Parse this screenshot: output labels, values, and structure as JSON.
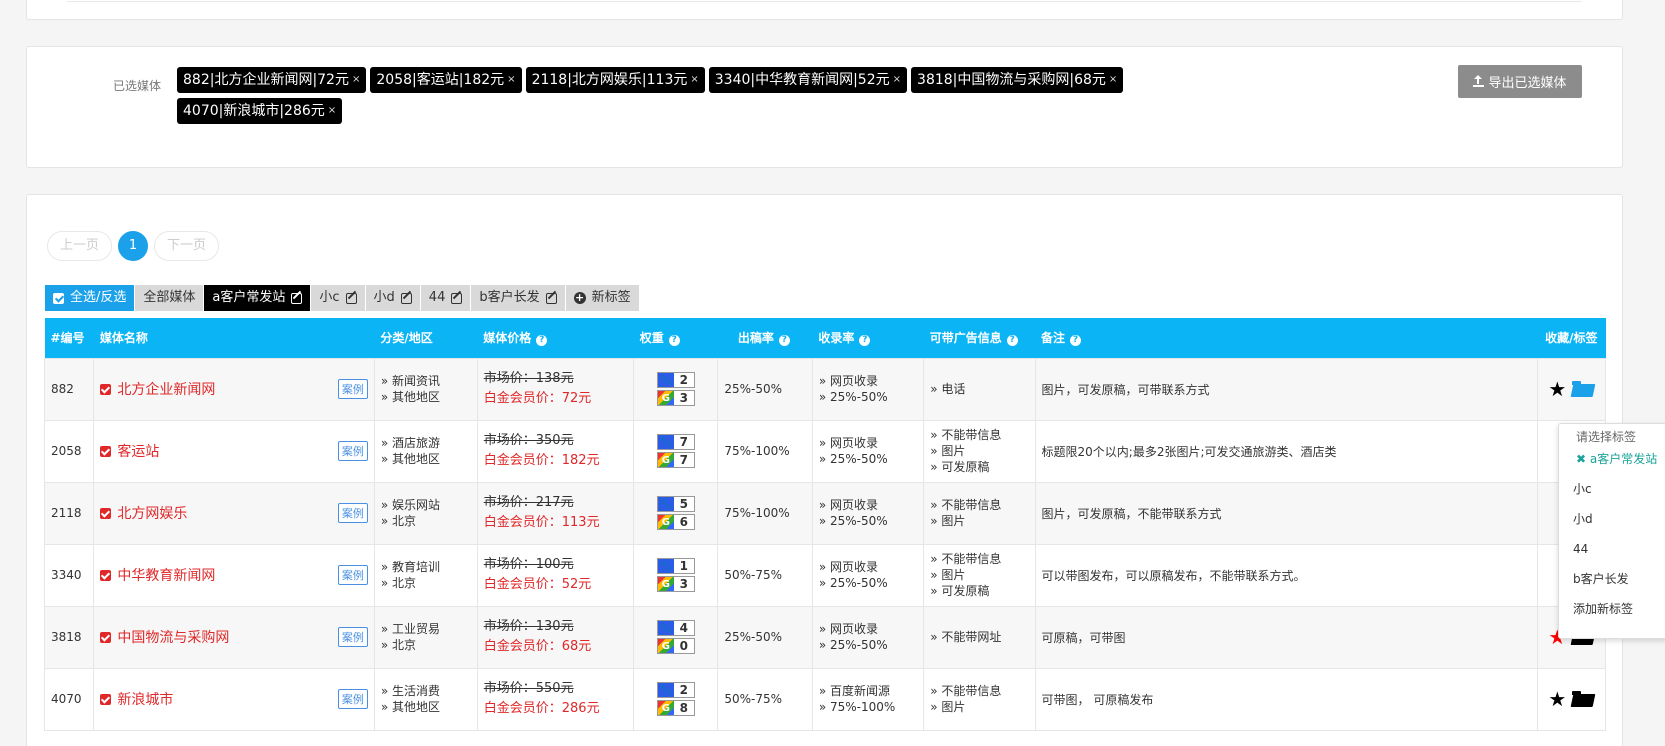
{
  "selected": {
    "label": "已选媒体",
    "tags": [
      "882|北方企业新闻网|72元",
      "2058|客运站|182元",
      "2118|北方网娱乐|113元",
      "3340|中华教育新闻网|52元",
      "3818|中国物流与采购网|68元",
      "4070|新浪城市|286元"
    ],
    "tag_close": "×",
    "export_label": "导出已选媒体"
  },
  "pager": {
    "prev": "上一页",
    "current": "1",
    "next": "下一页"
  },
  "tabs": {
    "select_all": "全选/反选",
    "all_media": "全部媒体",
    "items": [
      "a客户常发站",
      "小c",
      "小d",
      "44",
      "b客户长发"
    ],
    "new_tag": "新标签"
  },
  "table": {
    "headers": [
      "#编号",
      "媒体名称",
      "分类/地区",
      "媒体价格",
      "权重",
      "出稿率",
      "收录率",
      "可带广告信息",
      "备注",
      "收藏/标签"
    ],
    "case_label": "案例",
    "rows": [
      {
        "id": "882",
        "name": "北方企业新闻网",
        "cat": [
          "新闻资讯",
          "其他地区"
        ],
        "market": "市场价：138元",
        "vip": "白金会员价：72元",
        "baidu": "2",
        "google": "3",
        "rate": "25%-50%",
        "index": [
          "网页收录",
          "25%-50%"
        ],
        "ads": [
          "电话"
        ],
        "note": "图片，可发原稿，可带联系方式",
        "star_color": "#000000",
        "folder_color": "#1aa1ea"
      },
      {
        "id": "2058",
        "name": "客运站",
        "cat": [
          "酒店旅游",
          "其他地区"
        ],
        "market": "市场价：350元",
        "vip": "白金会员价：182元",
        "baidu": "7",
        "google": "7",
        "rate": "75%-100%",
        "index": [
          "网页收录",
          "25%-50%"
        ],
        "ads": [
          "不能带信息",
          "图片",
          "可发原稿"
        ],
        "note": "标题限20个以内;最多2张图片;可发交通旅游类、酒店类",
        "star_color": "",
        "folder_color": ""
      },
      {
        "id": "2118",
        "name": "北方网娱乐",
        "cat": [
          "娱乐网站",
          "北京"
        ],
        "market": "市场价：217元",
        "vip": "白金会员价：113元",
        "baidu": "5",
        "google": "6",
        "rate": "75%-100%",
        "index": [
          "网页收录",
          "25%-50%"
        ],
        "ads": [
          "不能带信息",
          "图片"
        ],
        "note": "图片，可发原稿，不能带联系方式",
        "star_color": "",
        "folder_color": ""
      },
      {
        "id": "3340",
        "name": "中华教育新闻网",
        "cat": [
          "教育培训",
          "北京"
        ],
        "market": "市场价：100元",
        "vip": "白金会员价：52元",
        "baidu": "1",
        "google": "3",
        "rate": "50%-75%",
        "index": [
          "网页收录",
          "25%-50%"
        ],
        "ads": [
          "不能带信息",
          "图片",
          "可发原稿"
        ],
        "note": "可以带图发布，可以原稿发布，不能带联系方式。",
        "star_color": "",
        "folder_color": ""
      },
      {
        "id": "3818",
        "name": "中国物流与采购网",
        "cat": [
          "工业贸易",
          "北京"
        ],
        "market": "市场价：130元",
        "vip": "白金会员价：68元",
        "baidu": "4",
        "google": "0",
        "rate": "25%-50%",
        "index": [
          "网页收录",
          "25%-50%"
        ],
        "ads": [
          "不能带网址"
        ],
        "note": "可原稿，可带图",
        "star_color": "#ff0000",
        "folder_color": "#000000"
      },
      {
        "id": "4070",
        "name": "新浪城市",
        "cat": [
          "生活消费",
          "其他地区"
        ],
        "market": "市场价：550元",
        "vip": "白金会员价：286元",
        "baidu": "2",
        "google": "8",
        "rate": "50%-75%",
        "index": [
          "百度新闻源",
          "75%-100%"
        ],
        "ads": [
          "不能带信息",
          "图片"
        ],
        "note": "可带图， 可原稿发布",
        "star_color": "#000000",
        "folder_color": "#000000"
      }
    ]
  },
  "tag_dropdown": {
    "header": "请选择标签",
    "selected_item": "a客户常发站",
    "selected_mark": "✖",
    "items": [
      "小c",
      "小d",
      "44",
      "b客户长发",
      "添加新标签"
    ]
  },
  "colors": {
    "accent": "#0bb5f5",
    "price_red": "#e0282a",
    "tag_bg": "#000000"
  }
}
